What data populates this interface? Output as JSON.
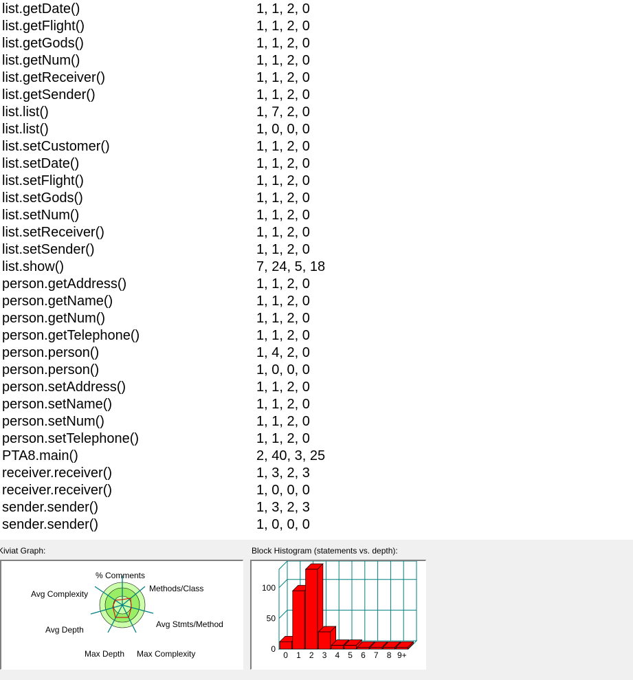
{
  "methods": [
    {
      "name": "list.getDate()",
      "values": "1, 1, 2, 0"
    },
    {
      "name": "list.getFlight()",
      "values": "1, 1, 2, 0"
    },
    {
      "name": "list.getGods()",
      "values": "1, 1, 2, 0"
    },
    {
      "name": "list.getNum()",
      "values": "1, 1, 2, 0"
    },
    {
      "name": "list.getReceiver()",
      "values": "1, 1, 2, 0"
    },
    {
      "name": "list.getSender()",
      "values": "1, 1, 2, 0"
    },
    {
      "name": "list.list()",
      "values": "1, 7, 2, 0"
    },
    {
      "name": "list.list()",
      "values": "1, 0, 0, 0"
    },
    {
      "name": "list.setCustomer()",
      "values": "1, 1, 2, 0"
    },
    {
      "name": "list.setDate()",
      "values": "1, 1, 2, 0"
    },
    {
      "name": "list.setFlight()",
      "values": "1, 1, 2, 0"
    },
    {
      "name": "list.setGods()",
      "values": "1, 1, 2, 0"
    },
    {
      "name": "list.setNum()",
      "values": "1, 1, 2, 0"
    },
    {
      "name": "list.setReceiver()",
      "values": "1, 1, 2, 0"
    },
    {
      "name": "list.setSender()",
      "values": "1, 1, 2, 0"
    },
    {
      "name": "list.show()",
      "values": "7, 24, 5, 18"
    },
    {
      "name": "person.getAddress()",
      "values": "1, 1, 2, 0"
    },
    {
      "name": "person.getName()",
      "values": "1, 1, 2, 0"
    },
    {
      "name": "person.getNum()",
      "values": "1, 1, 2, 0"
    },
    {
      "name": "person.getTelephone()",
      "values": "1, 1, 2, 0"
    },
    {
      "name": "person.person()",
      "values": "1, 4, 2, 0"
    },
    {
      "name": "person.person()",
      "values": "1, 0, 0, 0"
    },
    {
      "name": "person.setAddress()",
      "values": "1, 1, 2, 0"
    },
    {
      "name": "person.setName()",
      "values": "1, 1, 2, 0"
    },
    {
      "name": "person.setNum()",
      "values": "1, 1, 2, 0"
    },
    {
      "name": "person.setTelephone()",
      "values": "1, 1, 2, 0"
    },
    {
      "name": "PTA8.main()",
      "values": "2, 40, 3, 25"
    },
    {
      "name": "receiver.receiver()",
      "values": "1, 3, 2, 3"
    },
    {
      "name": "receiver.receiver()",
      "values": "1, 0, 0, 0"
    },
    {
      "name": "sender.sender()",
      "values": "1, 3, 2, 3"
    },
    {
      "name": "sender.sender()",
      "values": "1, 0, 0, 0"
    }
  ],
  "kiviat": {
    "caption": "Kiviat Graph:",
    "axes": {
      "comments": "% Comments",
      "methods_class": "Methods/Class",
      "avg_stmts": "Avg Stmts/Method",
      "max_complexity": "Max Complexity",
      "max_depth": "Max Depth",
      "avg_depth": "Avg Depth",
      "avg_complexity": "Avg Complexity"
    }
  },
  "histogram": {
    "caption": "Block Histogram (statements vs. depth):",
    "y_ticks": [
      "100",
      "50",
      "0"
    ],
    "chart_data": {
      "type": "bar",
      "title": "Block Histogram (statements vs. depth):",
      "categories": [
        "0",
        "1",
        "2",
        "3",
        "4",
        "5",
        "6",
        "7",
        "8",
        "9+"
      ],
      "values": [
        12,
        95,
        130,
        28,
        6,
        6,
        3,
        3,
        3,
        3
      ],
      "ylim": [
        0,
        130
      ],
      "bar_color": "#ff0000",
      "grid_color": "#008080"
    }
  },
  "colors": {
    "kiviat_fill": "#99ee66",
    "kiviat_band": "#ccffaa",
    "axis_teal": "#008080"
  }
}
